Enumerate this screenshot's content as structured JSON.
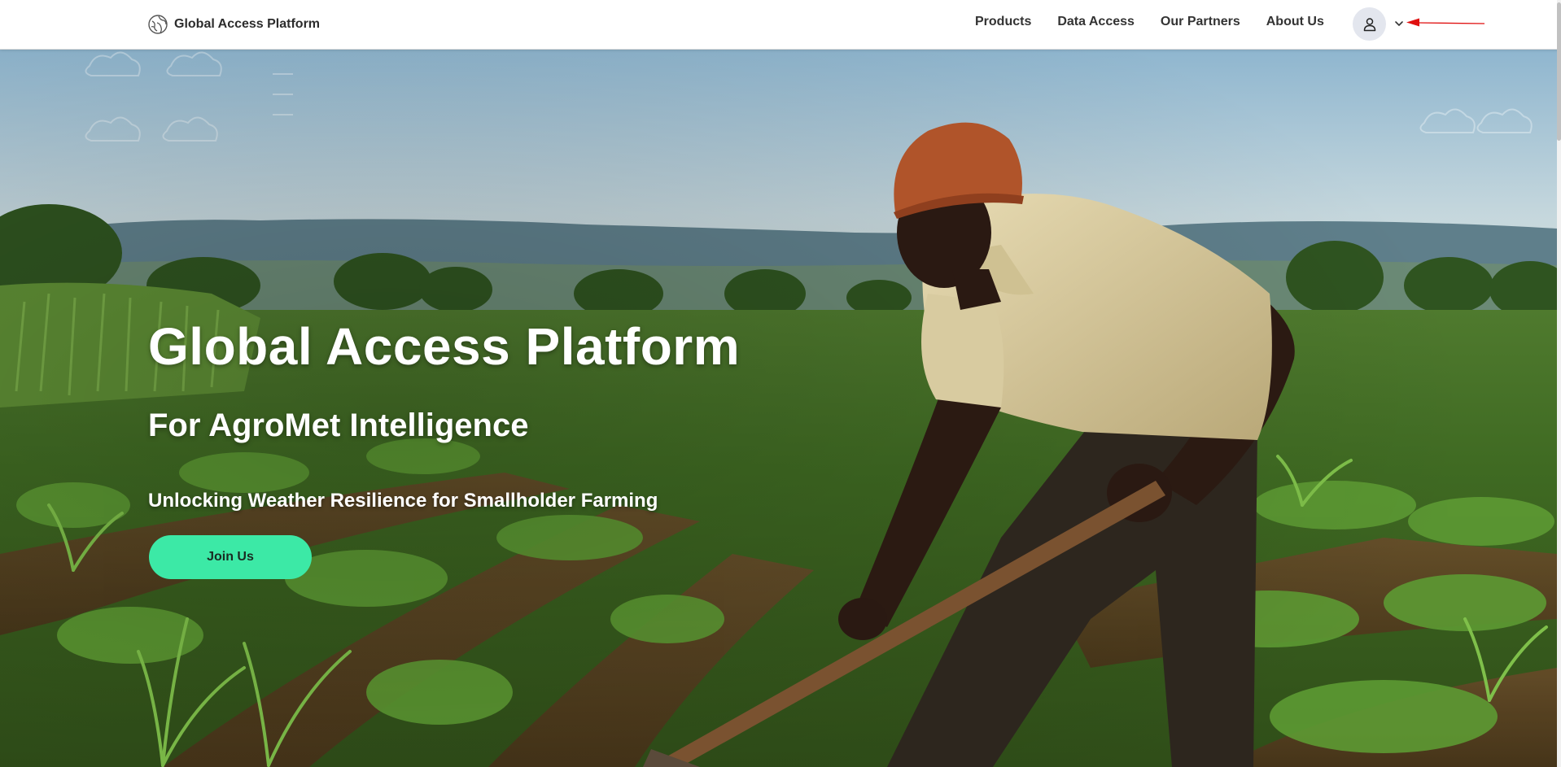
{
  "header": {
    "brand": "Global Access Platform",
    "nav": {
      "products": "Products",
      "data_access": "Data Access",
      "our_partners": "Our Partners",
      "about_us": "About Us"
    }
  },
  "hero": {
    "title": "Global Access Platform",
    "subtitle": "For AgroMet Intelligence",
    "tagline": "Unlocking Weather Resilience for Smallholder Farming",
    "cta_label": "Join Us"
  },
  "icons": {
    "logo": "globe-leaf-icon",
    "user": "user-icon",
    "dropdown": "chevron-down-icon",
    "annotation": "red-arrow-icon"
  },
  "colors": {
    "accent": "#3ce9a6",
    "annotation": "#e01010",
    "header_bg": "#ffffff"
  }
}
